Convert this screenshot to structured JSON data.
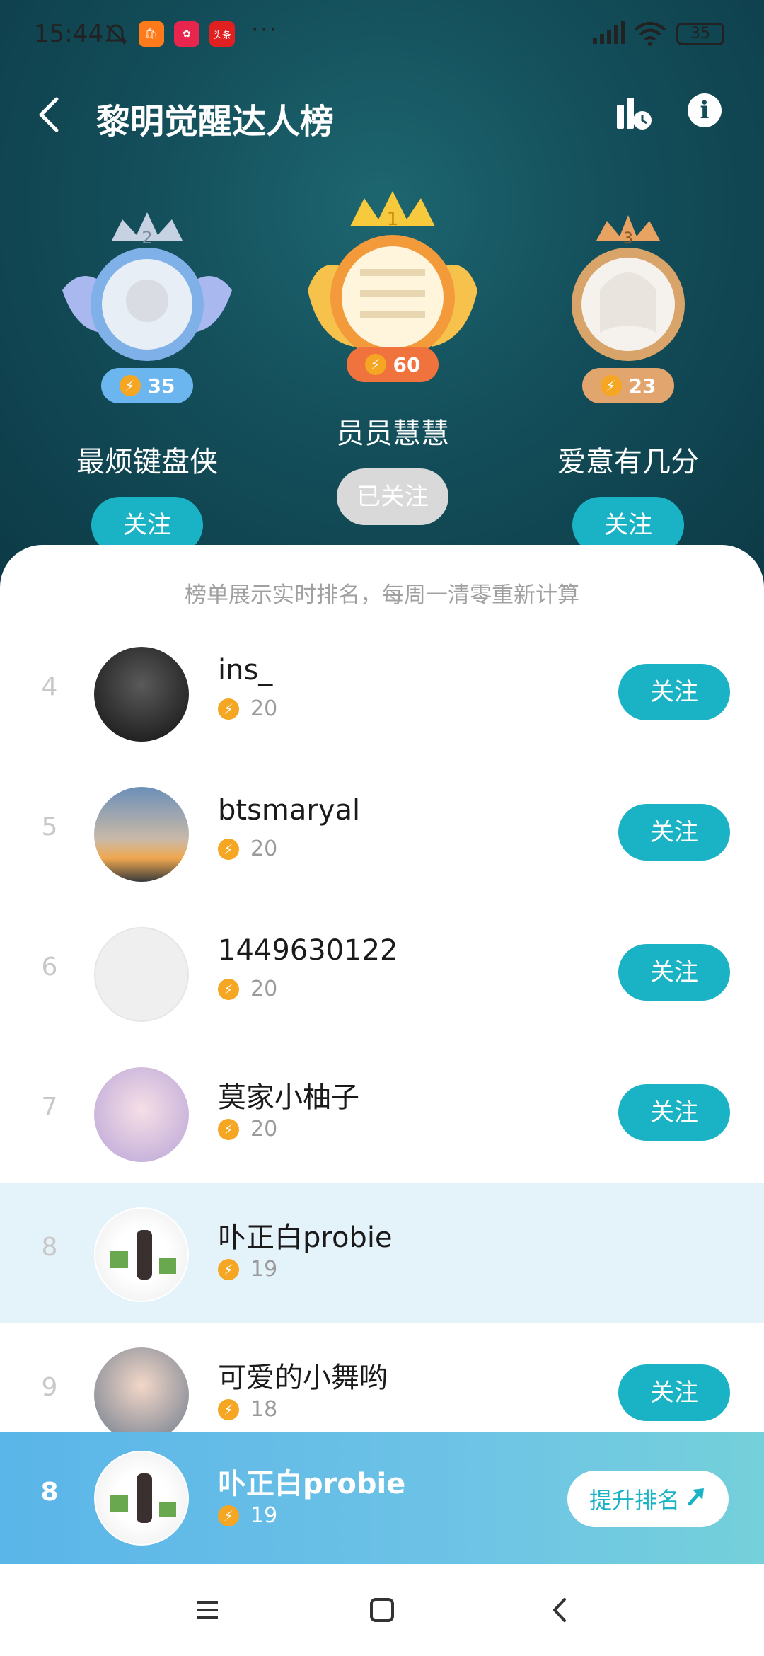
{
  "status_bar": {
    "time": "15:44",
    "app_badge_news": "头条",
    "more": "···",
    "battery": "35"
  },
  "header": {
    "title": "黎明觉醒达人榜",
    "back_icon": "chevron-left-icon",
    "stats_icon": "chart-clock-icon",
    "info_icon": "info-icon",
    "info_glyph": "i"
  },
  "podium": [
    {
      "rank": "2",
      "name": "最烦键盘侠",
      "score": "35",
      "follow_label": "关注",
      "followed": false
    },
    {
      "rank": "1",
      "name": "员员慧慧",
      "score": "60",
      "follow_label": "已关注",
      "followed": true
    },
    {
      "rank": "3",
      "name": "爱意有几分",
      "score": "23",
      "follow_label": "关注",
      "followed": false
    }
  ],
  "notice": "榜单展示实时排名，每周一清零重新计算",
  "list": [
    {
      "rank": "4",
      "name": "ins_",
      "score": "20",
      "follow_label": "关注"
    },
    {
      "rank": "5",
      "name": "btsmaryal",
      "score": "20",
      "follow_label": "关注"
    },
    {
      "rank": "6",
      "name": "1449630122",
      "score": "20",
      "follow_label": "关注"
    },
    {
      "rank": "7",
      "name": "莫家小柚子",
      "score": "20",
      "follow_label": "关注"
    },
    {
      "rank": "8",
      "name": "卟正白probie",
      "score": "19",
      "follow_label": ""
    },
    {
      "rank": "9",
      "name": "可爱的小舞哟",
      "score": "18",
      "follow_label": "关注"
    }
  ],
  "my_rank": {
    "rank": "8",
    "name": "卟正白probie",
    "score": "19",
    "boost_label": "提升排名"
  },
  "colors": {
    "accent": "#1ab3c6",
    "header_bg": "#134e5a",
    "score_bolt": "#f5a623",
    "highlight_row": "#e4f2fa"
  }
}
